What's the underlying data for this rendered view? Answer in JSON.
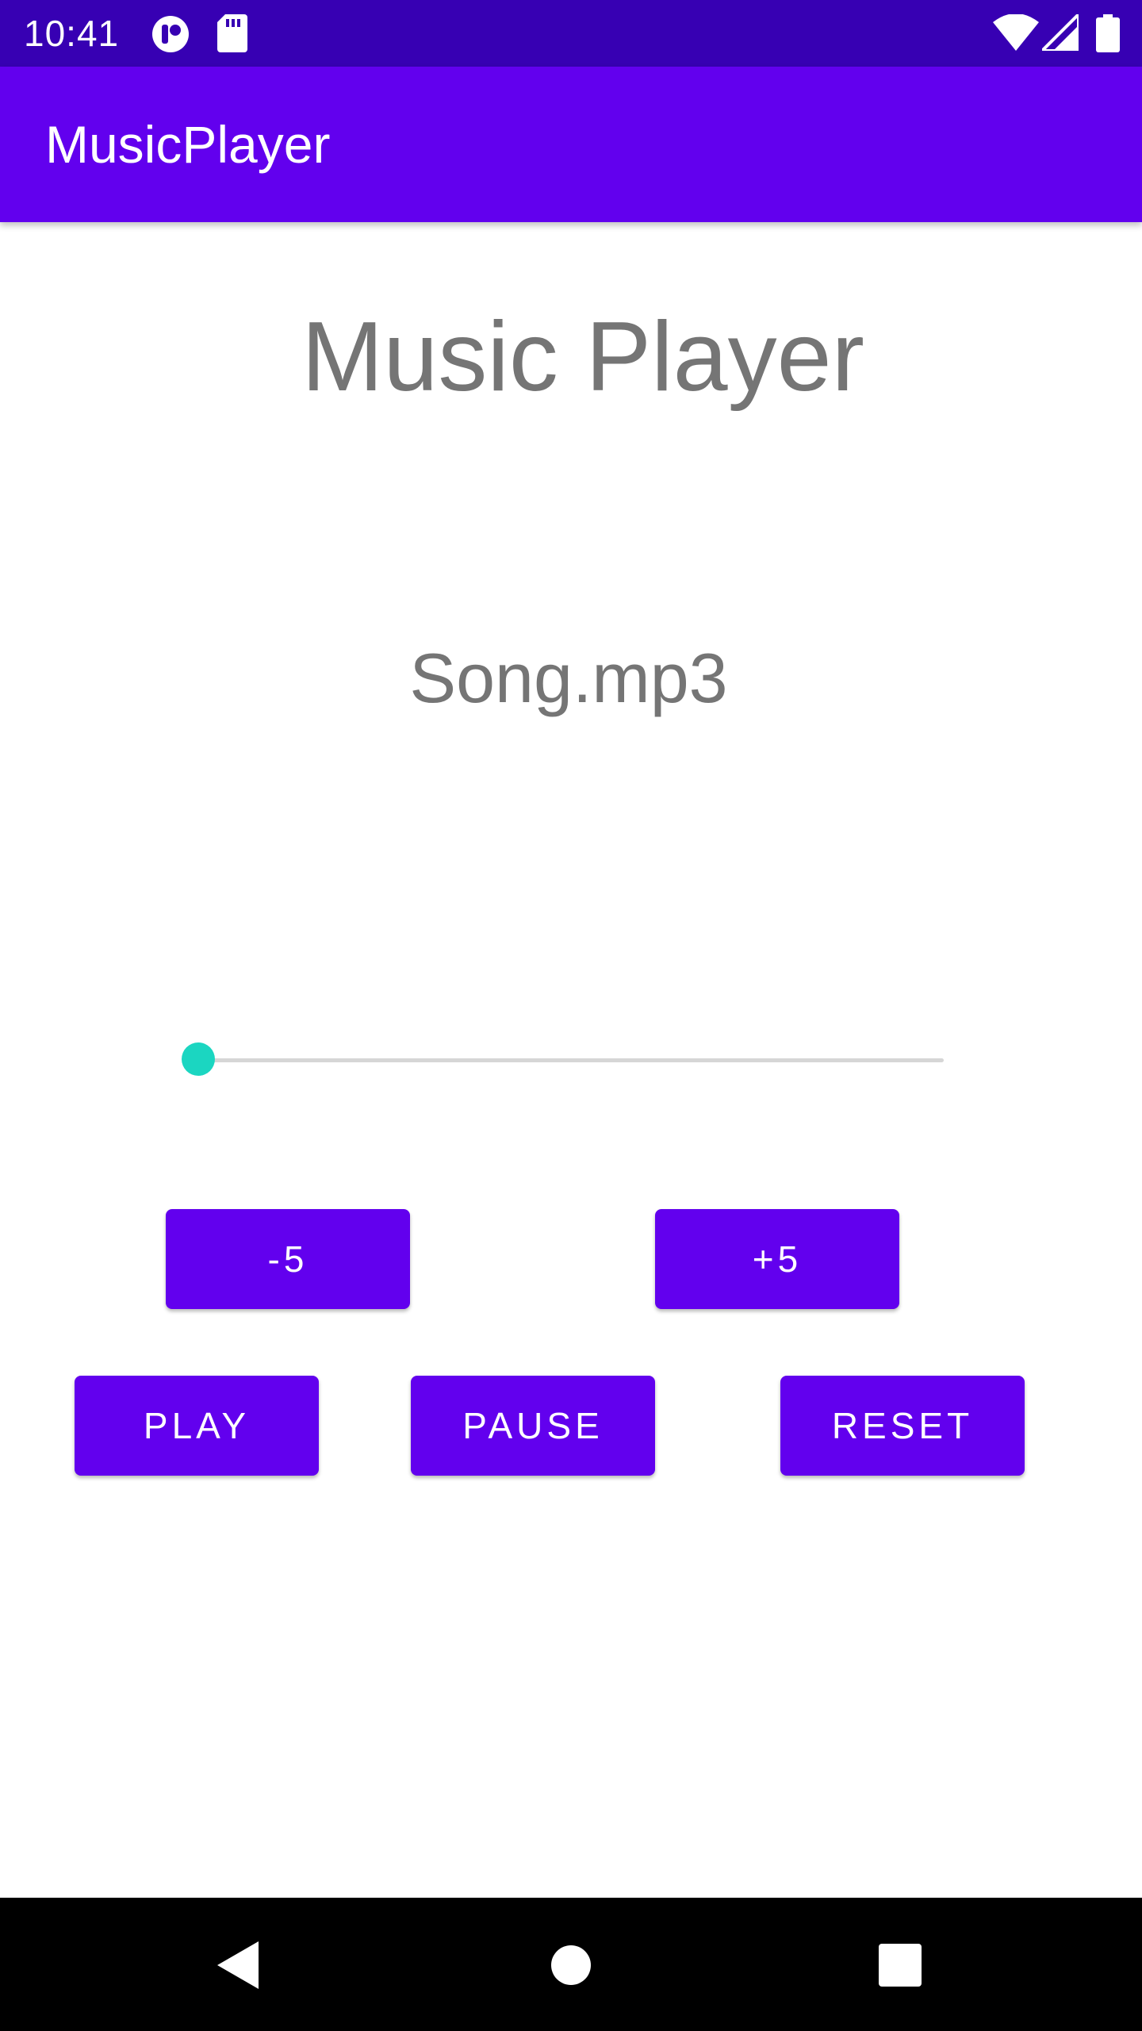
{
  "status_bar": {
    "time": "10:41",
    "left_icons": [
      "app-notification-icon",
      "sd-card-icon"
    ],
    "right_icons": [
      "wifi-icon",
      "cell-signal-icon",
      "battery-icon"
    ],
    "background": "#3700b3"
  },
  "app_bar": {
    "title": "MusicPlayer",
    "background": "#6200ee"
  },
  "main": {
    "heading": "Music Player",
    "song_name": "Song.mp3",
    "seekbar": {
      "progress": 0,
      "thumb_color": "#1bd6c1",
      "track_color": "#d6d6d6"
    },
    "buttons": {
      "rewind_label": "-5",
      "forward_label": "+5",
      "play_label": "PLAY",
      "pause_label": "PAUSE",
      "reset_label": "RESET"
    },
    "button_color": "#6200ee"
  },
  "nav_bar": {
    "icons": [
      "back-icon",
      "home-icon",
      "recents-icon"
    ]
  }
}
